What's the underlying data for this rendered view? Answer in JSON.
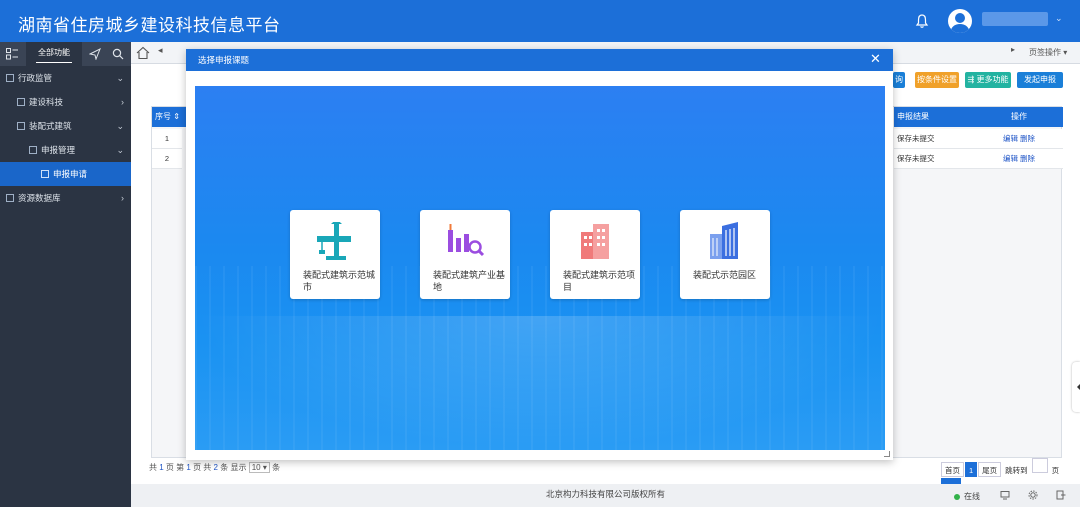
{
  "app": {
    "title": "湖南省住房城乡建设科技信息平台"
  },
  "sidebar": {
    "tab_all": "全部功能",
    "items": [
      {
        "label": "行政监管"
      },
      {
        "label": "建设科技"
      },
      {
        "label": "装配式建筑"
      },
      {
        "label": "申报管理"
      },
      {
        "label": "申报申请"
      },
      {
        "label": "资源数据库"
      }
    ]
  },
  "tabs": {
    "page_ops": "页签操作"
  },
  "toolbar": {
    "btn_query": "询",
    "btn_filter_settings": "按条件设置",
    "btn_more": "更多功能",
    "btn_submit": "发起申报"
  },
  "table": {
    "headers": {
      "seq": "序号",
      "result": "申报结果",
      "ops": "操作"
    },
    "rows": [
      {
        "seq": "1",
        "result": "保存未提交",
        "edit": "编辑",
        "delete": "删除"
      },
      {
        "seq": "2",
        "result": "保存未提交",
        "edit": "编辑",
        "delete": "删除"
      }
    ]
  },
  "pager": {
    "prefix": "共",
    "pages": "1",
    "mid1": "页 第",
    "current": "1",
    "mid2": "页 共",
    "total": "2",
    "mid3": "条 显示",
    "size": "10",
    "suffix": "条",
    "first": "首页",
    "page1": "1",
    "last": "尾页",
    "jump": "跳转到",
    "page_unit": "页",
    "go": "GO"
  },
  "footer": {
    "copyright": "北京构力科技有限公司版权所有",
    "online": "在线"
  },
  "modal": {
    "title": "选择申报课题",
    "cards": [
      {
        "label": "装配式建筑示范城市",
        "icon": "crane-icon",
        "color": "#19a7b8"
      },
      {
        "label": "装配式建筑产业基地",
        "icon": "chart-search-icon",
        "color": "#9b4de0"
      },
      {
        "label": "装配式建筑示范项目",
        "icon": "buildings-icon",
        "color": "#f07a7a"
      },
      {
        "label": "装配式示范园区",
        "icon": "tower-icon",
        "color": "#3b6fe0"
      }
    ]
  }
}
